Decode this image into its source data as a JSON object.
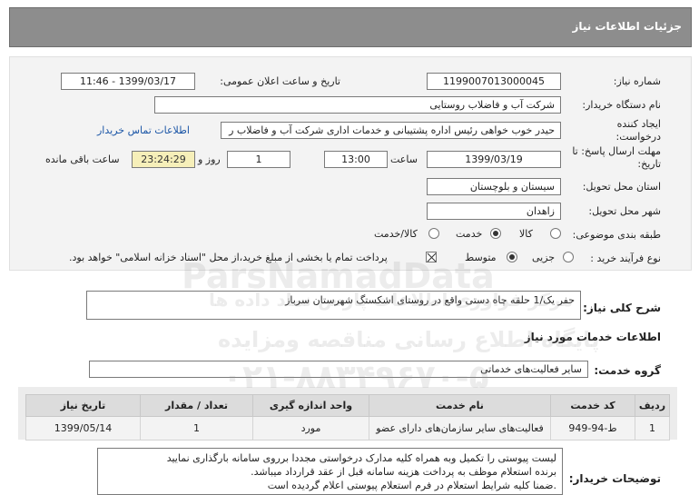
{
  "header": {
    "title": "جزئیات اطلاعات نیاز"
  },
  "fields": {
    "need_number_label": "شماره نیاز:",
    "need_number": "1199007013000045",
    "announce_label": "تاریخ و ساعت اعلان عمومی:",
    "announce_value": "1399/03/17 - 11:46",
    "buyer_org_label": "نام دستگاه خریدار:",
    "buyer_org": "شرکت آب و فاضلاب روستایی",
    "creator_label": "ایجاد کننده درخواست:",
    "creator": "حیدر خوب خواهی  رئیس اداره پشتیبانی و خدمات اداری  شرکت آب و فاضلاب ر",
    "contact_link": "اطلاعات تماس خریدار",
    "deadline_label": "مهلت ارسال پاسخ: تا تاریخ:",
    "deadline_date": "1399/03/19",
    "time_label": "ساعت",
    "deadline_time": "13:00",
    "days_value": "1",
    "days_label": "روز و",
    "remaining_time": "23:24:29",
    "remaining_label": "ساعت باقی مانده",
    "province_label": "استان محل تحویل:",
    "province": "سیستان و بلوچستان",
    "city_label": "شهر محل تحویل:",
    "city": "زاهدان",
    "category_label": "طبقه بندی موضوعی:",
    "category_options": [
      "کالا",
      "خدمت",
      "کالا/خدمت"
    ],
    "category_selected": "خدمت",
    "process_label": "نوع فرآیند خرید :",
    "process_options": [
      "جزیی",
      "متوسط"
    ],
    "process_selected": "متوسط",
    "payment_note": "پرداخت تمام یا بخشی از مبلغ خرید،از محل \"اسناد خزانه اسلامی\" خواهد بود."
  },
  "summary": {
    "label": "شرح کلی نیاز:",
    "text": "حفر یک/1 حلقه چاه دستی واقع در روستای اشکستگ شهرستان سرباز"
  },
  "services": {
    "section_title": "اطلاعات خدمات مورد نیاز",
    "group_label": "گروه خدمت:",
    "group_value": "سایر فعالیت‌های خدماتی",
    "columns": [
      "ردیف",
      "کد خدمت",
      "نام خدمت",
      "واحد اندازه گیری",
      "تعداد / مقدار",
      "تاریخ نیاز"
    ],
    "rows": [
      [
        "1",
        "ط-94-949",
        "فعالیت‌های سایر سازمان‌های دارای عضو",
        "مورد",
        "1",
        "1399/05/14"
      ]
    ]
  },
  "buyer_notes": {
    "label": "توضیحات خریدار:",
    "lines": [
      "لیست پیوستی را تکمیل وبه همراه کلیه مدارک درخواستی مجددا برروی سامانه بارگذاری نمایید",
      "برنده استعلام موظف به پرداخت هزینه سامانه قبل از عقد قرارداد میباشد.",
      ".ضمنا کلیه شرایط استعلام در فرم استعلام پیوستی اعلام گردیده است"
    ]
  },
  "watermark": {
    "line1": "ParsNamadData",
    "line2": "مرکز فراوری اطلاعات پارس نماد داده ها",
    "line3": "پایگاه اطلاع رسانی مناقصه ومزایده",
    "line4": "۰۲۱-۸۸۳۴۹۶۷۰-۵"
  }
}
